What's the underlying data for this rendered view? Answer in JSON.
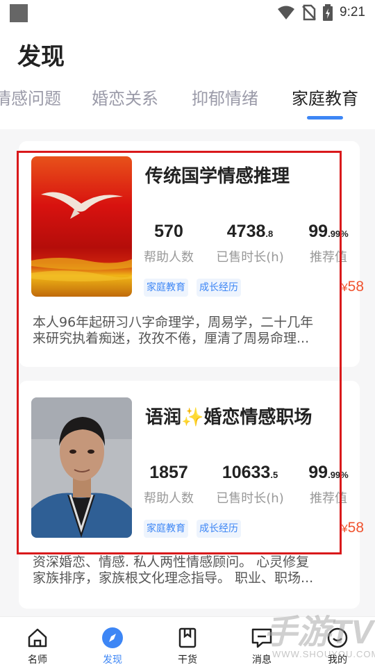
{
  "status_bar": {
    "time": "9:21"
  },
  "page_title": "发现",
  "tabs": [
    {
      "label": "情感问题"
    },
    {
      "label": "婚恋关系"
    },
    {
      "label": "抑郁情绪"
    },
    {
      "label": "家庭教育"
    }
  ],
  "active_tab": "家庭教育",
  "cards": [
    {
      "title": "传统国学情感推理",
      "stats": [
        {
          "value": "570",
          "decimal": "",
          "label": "帮助人数"
        },
        {
          "value": "4738",
          "decimal": ".8",
          "label": "已售时长(h)"
        },
        {
          "value": "99",
          "decimal": ".99%",
          "label": "推荐值"
        }
      ],
      "tags": [
        "家庭教育",
        "成长经历"
      ],
      "price": "58",
      "currency": "¥",
      "description_line1": "本人96年起研习八字命理学，周易学，二十几年",
      "description_line2": "来研究执着痴迷，孜孜不倦，厘清了周易命理..."
    },
    {
      "title": "语润✨婚恋情感职场",
      "stats": [
        {
          "value": "1857",
          "decimal": "",
          "label": "帮助人数"
        },
        {
          "value": "10633",
          "decimal": ".5",
          "label": "已售时长(h)"
        },
        {
          "value": "99",
          "decimal": ".99%",
          "label": "推荐值"
        }
      ],
      "tags": [
        "家庭教育",
        "成长经历"
      ],
      "price": "58",
      "currency": "¥",
      "description_line1": "资深婚恋、情感. 私人两性情感顾问。 心灵修复",
      "description_line2": " 家族排序，家族根文化理念指导。 职业、职场..."
    }
  ],
  "bottom_nav": [
    {
      "label": "名师",
      "icon": "home-icon"
    },
    {
      "label": "发现",
      "icon": "compass-icon"
    },
    {
      "label": "干货",
      "icon": "bookmark-icon"
    },
    {
      "label": "消息",
      "icon": "message-icon"
    },
    {
      "label": "我的",
      "icon": "smile-icon"
    }
  ],
  "active_nav": "发现",
  "watermark": {
    "text": "手游TV",
    "sub": "WWW.SHOUYOU.COM"
  },
  "colors": {
    "accent": "#3d86f5",
    "price": "#f0532f",
    "highlight": "#d9191b"
  }
}
